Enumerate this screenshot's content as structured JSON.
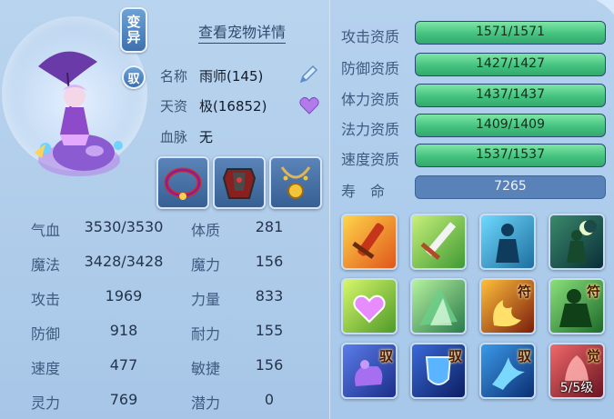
{
  "badges": {
    "mutated": "变异",
    "tame": "驭"
  },
  "details_link": "查看宠物详情",
  "info": {
    "name_label": "名称",
    "name_value": "雨师(145)",
    "aptitude_label": "天资",
    "aptitude_value": "极(16852)",
    "bloodline_label": "血脉",
    "bloodline_value": "无"
  },
  "equipment": [
    {
      "name": "pet-collar-icon"
    },
    {
      "name": "pet-armor-icon"
    },
    {
      "name": "pet-necklace-icon"
    }
  ],
  "stats": [
    {
      "label": "气血",
      "value": "3530/3530",
      "label2": "体质",
      "value2": "281"
    },
    {
      "label": "魔法",
      "value": "3428/3428",
      "label2": "魔力",
      "value2": "156"
    },
    {
      "label": "攻击",
      "value": "1969",
      "label2": "力量",
      "value2": "833"
    },
    {
      "label": "防御",
      "value": "918",
      "label2": "耐力",
      "value2": "155"
    },
    {
      "label": "速度",
      "value": "477",
      "label2": "敏捷",
      "value2": "156"
    },
    {
      "label": "灵力",
      "value": "769",
      "label2": "潜力",
      "value2": "0"
    }
  ],
  "aptitudes": [
    {
      "label": "攻击资质",
      "value": "1571/1571",
      "fill": 1.0
    },
    {
      "label": "防御资质",
      "value": "1427/1427",
      "fill": 1.0
    },
    {
      "label": "体力资质",
      "value": "1437/1437",
      "fill": 1.0
    },
    {
      "label": "法力资质",
      "value": "1409/1409",
      "fill": 1.0
    },
    {
      "label": "速度资质",
      "value": "1537/1537",
      "fill": 1.0
    }
  ],
  "lifespan": {
    "label": "寿　命",
    "value": "7265"
  },
  "skills": [
    {
      "name": "fire-sword-skill-icon",
      "tag": "",
      "level": ""
    },
    {
      "name": "sword-strike-skill-icon",
      "tag": "",
      "level": ""
    },
    {
      "name": "shadow-figure-skill-icon",
      "tag": "",
      "level": ""
    },
    {
      "name": "night-warrior-skill-icon",
      "tag": "",
      "level": ""
    },
    {
      "name": "heart-shield-skill-icon",
      "tag": "",
      "level": ""
    },
    {
      "name": "green-shard-skill-icon",
      "tag": "",
      "level": ""
    },
    {
      "name": "fire-talisman-skill-icon",
      "tag": "符",
      "level": ""
    },
    {
      "name": "green-giant-skill-icon",
      "tag": "符",
      "level": ""
    },
    {
      "name": "purple-fist-skill-icon",
      "tag": "驭",
      "level": ""
    },
    {
      "name": "blue-shield-skill-icon",
      "tag": "驭",
      "level": ""
    },
    {
      "name": "dash-skill-icon",
      "tag": "驭",
      "level": ""
    },
    {
      "name": "awakened-skill-icon",
      "tag": "觉",
      "level": "5/5级"
    }
  ]
}
